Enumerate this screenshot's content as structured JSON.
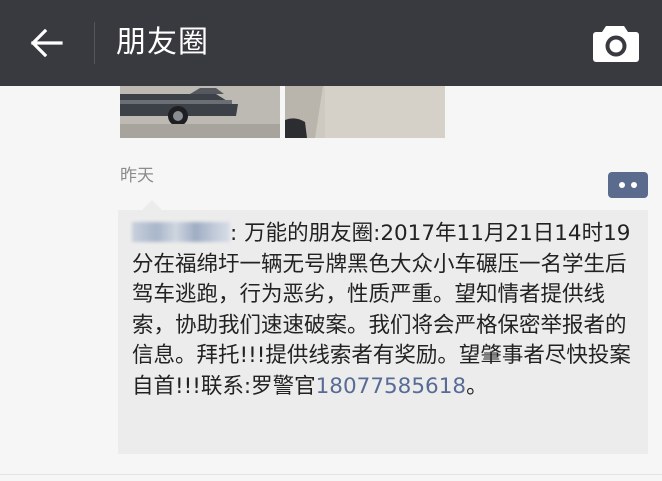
{
  "header": {
    "title": "朋友圈",
    "back_icon": "arrow-left-icon",
    "camera_icon": "camera-icon",
    "background_color": "#393a3f"
  },
  "feed": {
    "timestamp": "昨天",
    "comment_icon": "comment-icon",
    "accent_color": "#576b95",
    "comment": {
      "author_name_obscured": true,
      "separator": ": ",
      "text_main": "万能的朋友圈:2017年11月21日14时19分在福绵圩一辆无号牌黑色大众小车碾压一名学生后驾车逃跑，行为恶劣，性质严重。望知情者提供线索，协助我们速速破案。我们将会严格保密举报者的信息。拜托!!!提供线索者有奖励。望肇事者尽快投案自首!!!联系:罗警官",
      "phone": "18077585618",
      "text_end": "。"
    }
  }
}
